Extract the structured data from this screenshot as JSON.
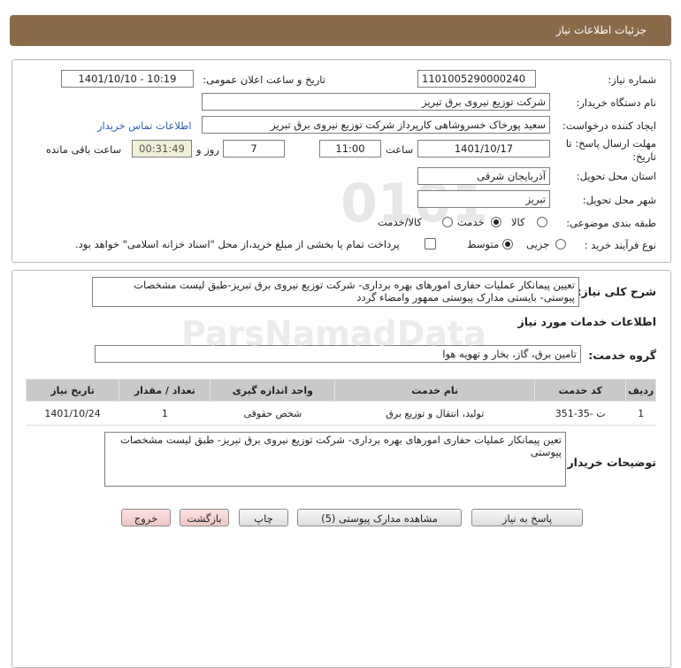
{
  "header": {
    "title": "جزئیات اطلاعات نیاز"
  },
  "form": {
    "need_number_label": "شماره نیاز:",
    "need_number": "1101005290000240",
    "announce_label": "تاریخ و ساعت اعلان عمومی:",
    "announce_value": "1401/10/10 - 10:19",
    "buyer_org_label": "نام دستگاه خریدار:",
    "buyer_org": "شرکت توزیع نیروی برق تبریز",
    "creator_label": "ایجاد کننده درخواست:",
    "creator": "سعید پورخاک خسروشاهی کارپرداز شرکت توزیع نیروی برق تبریز",
    "contact_link": "اطلاعات تماس خریدار",
    "deadline_label_1": "مهلت ارسال پاسخ: تا",
    "deadline_label_2": "تاریخ:",
    "deadline_date": "1401/10/17",
    "time_label": "ساعت",
    "deadline_time": "11:00",
    "days_value": "7",
    "days_label": "روز و",
    "timer_value": "00:31:49",
    "remaining_label": "ساعت باقی مانده",
    "province_label": "استان محل تحویل:",
    "province": "آذربایجان شرقی",
    "city_label": "شهر محل تحویل:",
    "city": "تبریز",
    "category_label": "طبقه بندی موضوعی:",
    "category_options": [
      "کالا",
      "خدمت",
      "کالا/خدمت"
    ],
    "category_selected": "خدمت",
    "process_label": "نوع فرآیند خرید :",
    "process_options": [
      "جزیی",
      "متوسط"
    ],
    "process_selected": "متوسط",
    "payment_note": "پرداخت تمام یا بخشی از مبلغ خرید،از محل \"اسناد خزانه اسلامی\" خواهد بود."
  },
  "description": {
    "label": "شرح کلی نیاز:",
    "text": "تعیین پیمانکار عملیات حفاری امورهای بهره برداری- شرکت توزیع نیروی برق تبریز-طبق لیست مشخصات پیوستی- بایستی مدارک پیوستی ممهور وامضاء گردد"
  },
  "services": {
    "section_title": "اطلاعات خدمات مورد نیاز",
    "group_label": "گروه خدمت:",
    "group_value": "تامین برق، گاز، بخار و تهویه هوا",
    "columns": [
      "ردیف",
      "کد خدمت",
      "نام خدمت",
      "واحد اندازه گیری",
      "تعداد / مقدار",
      "تاریخ نیاز"
    ],
    "rows": [
      [
        "1",
        "ت -35-351",
        "تولید، انتقال و توزیع برق",
        "شخص حقوقی",
        "1",
        "1401/10/24"
      ]
    ]
  },
  "buyer_notes": {
    "label": "توضیحات خریدار:",
    "text": "تعین پیمانکار عملیات حفاری امورهای بهره برداری- شرکت توزیع نیروی برق تبریز- طبق لیست مشخصات پیوستی"
  },
  "buttons": {
    "reply": "پاسخ به نیاز",
    "attachments": "مشاهده مدارک پیوستی (5)",
    "print": "چاپ",
    "back": "بازگشت",
    "exit": "خروج"
  }
}
